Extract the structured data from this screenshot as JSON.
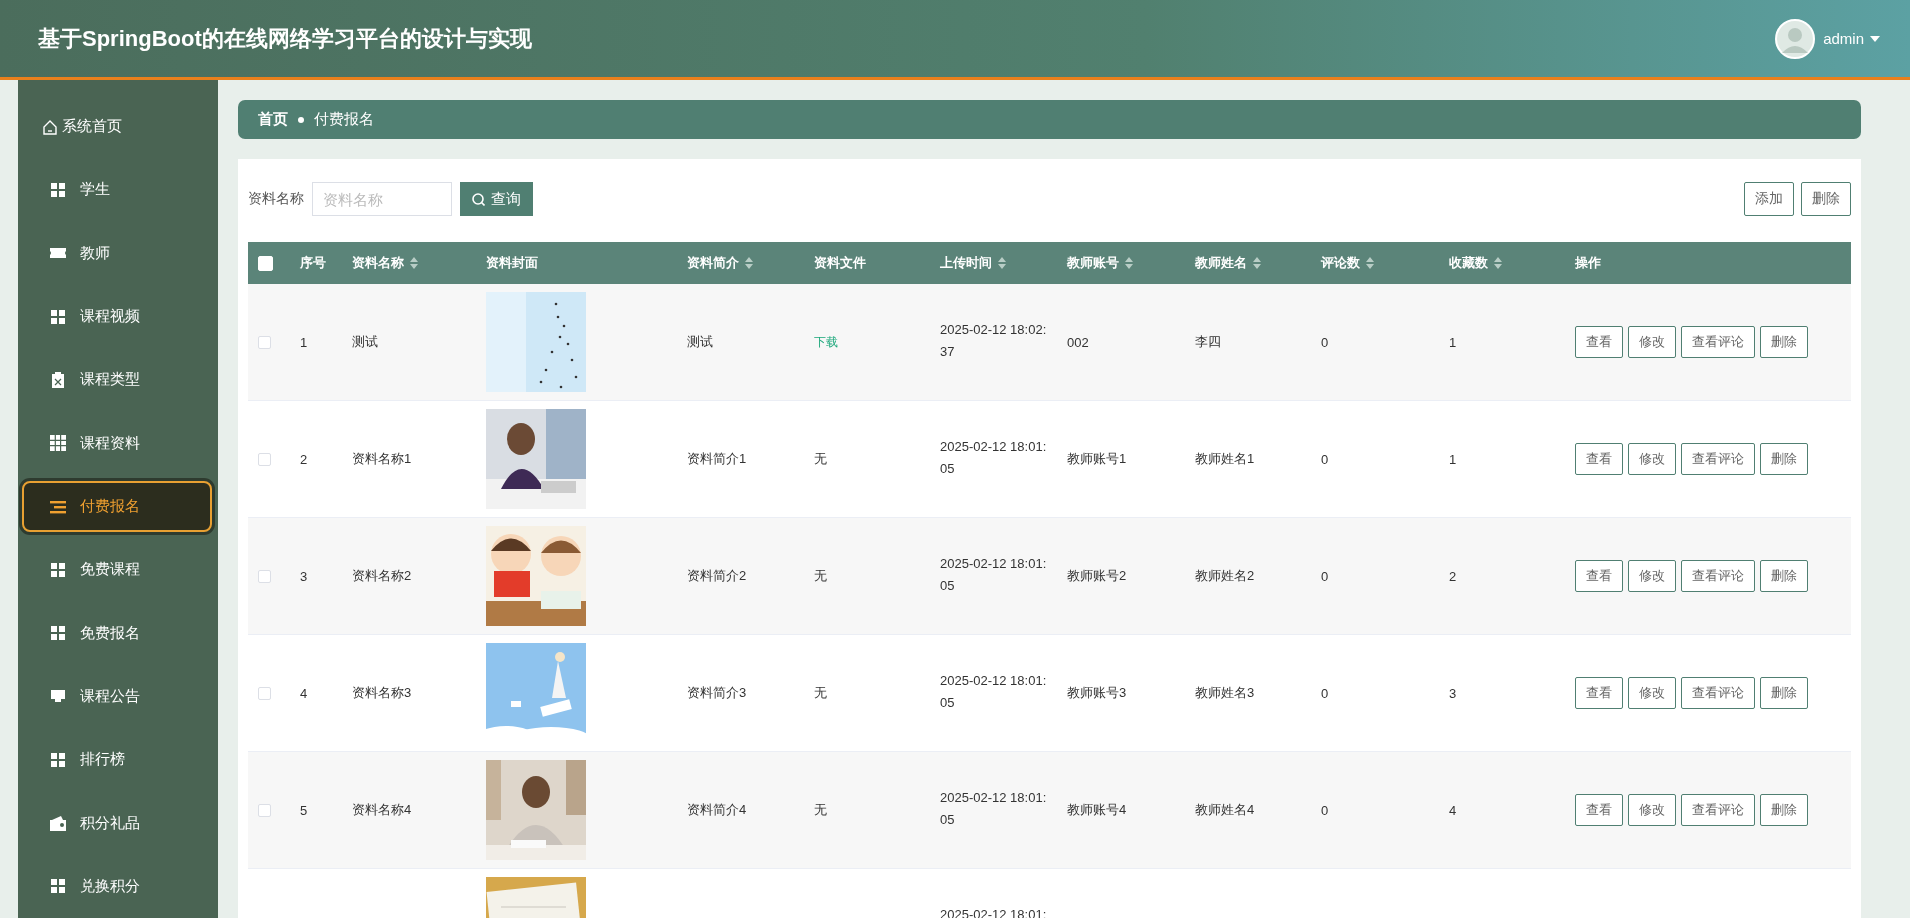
{
  "header": {
    "title": "基于SpringBoot的在线网络学习平台的设计与实现",
    "user": "admin"
  },
  "sidebar": {
    "items": [
      {
        "label": "系统首页",
        "kind": "home",
        "selected": false
      },
      {
        "label": "学生",
        "kind": "grid",
        "selected": false
      },
      {
        "label": "教师",
        "kind": "ticket",
        "selected": false
      },
      {
        "label": "课程视频",
        "kind": "grid",
        "selected": false
      },
      {
        "label": "课程类型",
        "kind": "clipboard",
        "selected": false
      },
      {
        "label": "课程资料",
        "kind": "table",
        "selected": false
      },
      {
        "label": "付费报名",
        "kind": "list",
        "selected": true
      },
      {
        "label": "免费课程",
        "kind": "grid",
        "selected": false
      },
      {
        "label": "免费报名",
        "kind": "grid",
        "selected": false
      },
      {
        "label": "课程公告",
        "kind": "tray",
        "selected": false
      },
      {
        "label": "排行榜",
        "kind": "grid",
        "selected": false
      },
      {
        "label": "积分礼品",
        "kind": "wallet",
        "selected": false
      },
      {
        "label": "兑换积分",
        "kind": "grid",
        "selected": false
      }
    ]
  },
  "breadcrumb": [
    "首页",
    "付费报名"
  ],
  "search": {
    "label": "资料名称",
    "placeholder": "资料名称",
    "button": "查询"
  },
  "toolbar": [
    "添加",
    "删除"
  ],
  "table": {
    "select_all": {
      "checked": false
    },
    "columns": [
      {
        "label": "序号",
        "sortable": false
      },
      {
        "label": "资料名称",
        "sortable": true
      },
      {
        "label": "资料封面",
        "sortable": false
      },
      {
        "label": "资料简介",
        "sortable": true
      },
      {
        "label": "资料文件",
        "sortable": false
      },
      {
        "label": "上传时间",
        "sortable": true
      },
      {
        "label": "教师账号",
        "sortable": true
      },
      {
        "label": "教师姓名",
        "sortable": true
      },
      {
        "label": "评论数",
        "sortable": true
      },
      {
        "label": "收藏数",
        "sortable": true
      },
      {
        "label": "操作",
        "sortable": false
      }
    ],
    "rows": [
      {
        "checked": false,
        "index": "1",
        "name": "测试",
        "intro": "测试",
        "file": {
          "kind": "link",
          "text": "下载"
        },
        "time": "2025-02-12 18:02:37",
        "account": "002",
        "teacher": "李四",
        "comments": "0",
        "favorites": "1",
        "actions": [
          "查看",
          "修改",
          "查看评论",
          "删除"
        ]
      },
      {
        "checked": false,
        "index": "2",
        "name": "资料名称1",
        "intro": "资料简介1",
        "file": {
          "kind": "text",
          "text": "无"
        },
        "time": "2025-02-12 18:01:05",
        "account": "教师账号1",
        "teacher": "教师姓名1",
        "comments": "0",
        "favorites": "1",
        "actions": [
          "查看",
          "修改",
          "查看评论",
          "删除"
        ]
      },
      {
        "checked": false,
        "index": "3",
        "name": "资料名称2",
        "intro": "资料简介2",
        "file": {
          "kind": "text",
          "text": "无"
        },
        "time": "2025-02-12 18:01:05",
        "account": "教师账号2",
        "teacher": "教师姓名2",
        "comments": "0",
        "favorites": "2",
        "actions": [
          "查看",
          "修改",
          "查看评论",
          "删除"
        ]
      },
      {
        "checked": false,
        "index": "4",
        "name": "资料名称3",
        "intro": "资料简介3",
        "file": {
          "kind": "text",
          "text": "无"
        },
        "time": "2025-02-12 18:01:05",
        "account": "教师账号3",
        "teacher": "教师姓名3",
        "comments": "0",
        "favorites": "3",
        "actions": [
          "查看",
          "修改",
          "查看评论",
          "删除"
        ]
      },
      {
        "checked": false,
        "index": "5",
        "name": "资料名称4",
        "intro": "资料简介4",
        "file": {
          "kind": "text",
          "text": "无"
        },
        "time": "2025-02-12 18:01:05",
        "account": "教师账号4",
        "teacher": "教师姓名4",
        "comments": "0",
        "favorites": "4",
        "actions": [
          "查看",
          "修改",
          "查看评论",
          "删除"
        ]
      },
      {
        "time": "2025-02-12 18:01:"
      }
    ]
  }
}
